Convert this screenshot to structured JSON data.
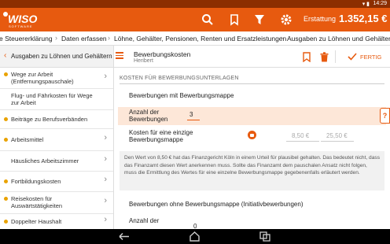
{
  "status_bar": {
    "time": "14:29"
  },
  "app_bar": {
    "logo_text": "WISO",
    "logo_sub": "SOFTWARE",
    "refund_label": "Erstattung",
    "refund_value": "1.352,15 €"
  },
  "breadcrumb": [
    "e Steuererklärung",
    "Daten erfassen",
    "Löhne, Gehälter, Pensionen, Renten und Ersatzleistungen",
    "Ausgaben zu Löhnen und Gehältern"
  ],
  "sidebar": {
    "title": "Ausgaben zu Löhnen und Gehältern",
    "items": [
      {
        "label": "Wege zur Arbeit (Entfernungspauschale)",
        "dot": true,
        "chevron": true
      },
      {
        "label": "Flug- und Fährkosten für Wege zur Arbeit",
        "dot": false,
        "chevron": false
      },
      {
        "label": "Beiträge zu Berufsverbänden",
        "dot": true,
        "chevron": false
      },
      {
        "label": "Arbeitsmittel",
        "dot": true,
        "chevron": true
      },
      {
        "label": "Häusliches Arbeitszimmer",
        "dot": false,
        "chevron": true
      },
      {
        "label": "Fortbildungskosten",
        "dot": true,
        "chevron": true
      },
      {
        "label": "Reisekosten für Auswärtstätigkeiten",
        "dot": true,
        "chevron": true
      },
      {
        "label": "Doppelter Haushalt",
        "dot": true,
        "chevron": true
      }
    ]
  },
  "content_header": {
    "title": "Bewerbungskosten",
    "subtitle": "Heribert",
    "done_label": "FERTIG"
  },
  "form": {
    "section_title": "KOSTEN FÜR BEWERBUNGSUNTERLAGEN",
    "with_folder_label": "Bewerbungen mit Bewerbungsmappe",
    "count_label_1": "Anzahl der",
    "count_label_2": "Bewerbungen",
    "count_value": "3",
    "help_label": "?",
    "cost_label_1": "Kosten für eine einzige",
    "cost_label_2": "Bewerbungsmappe",
    "cost_value_1": "8,50 €",
    "cost_value_2": "25,50 €",
    "note": "Den Wert von 8,50 € hat das Finanzgericht Köln in einem Urteil für plausibel gehalten. Das bedeutet nicht, dass das Finanzamt diesen Wert anerkennen muss. Sollte das Finanzamt dem pauschalen Ansatz nicht folgen, muss die Ermittlung des Wertes für eine einzelne Bewerbungsmappe gegebenenfalls erläutert werden.",
    "without_folder_label": "Bewerbungen ohne Bewerbungsmappe (Initiativbewerbungen)",
    "count2_label_1": "Anzahl der",
    "count2_value": "0"
  }
}
